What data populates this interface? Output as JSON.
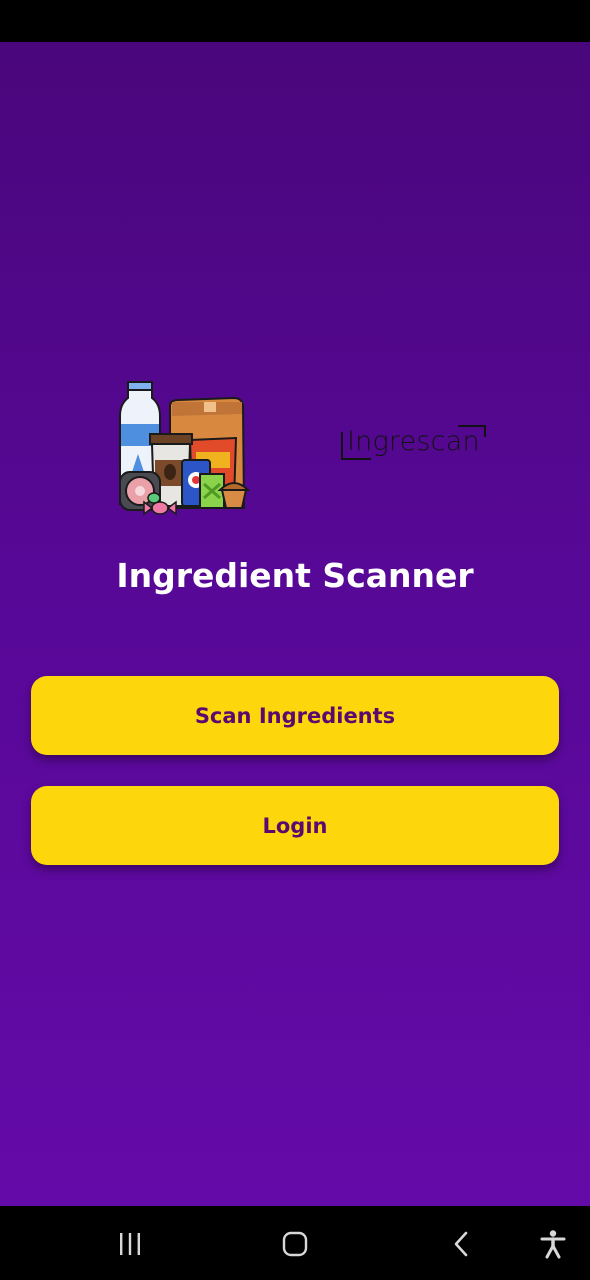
{
  "app": {
    "title": "Ingredient Scanner",
    "brand": "Ingrescan"
  },
  "buttons": {
    "scan_label": "Scan Ingredients",
    "login_label": "Login"
  },
  "nav_bar": {
    "items": [
      "recent-apps-icon",
      "home-icon",
      "back-icon",
      "accessibility-icon"
    ]
  },
  "colors": {
    "background_top": "#4a067c",
    "background_bottom": "#640aa8",
    "button": "#fdd70b",
    "button_text": "#5a0a6e",
    "title_text": "#ffffff"
  }
}
